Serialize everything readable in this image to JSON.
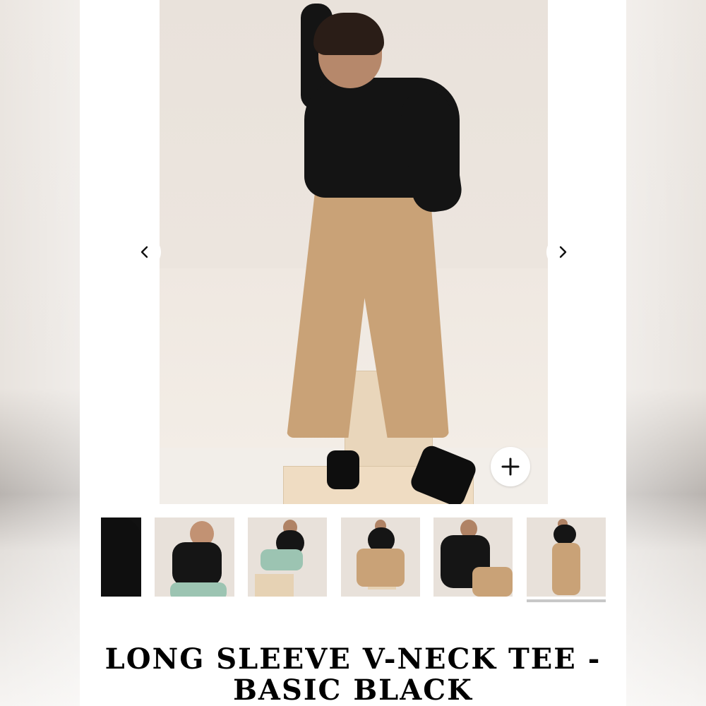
{
  "product": {
    "title": "LONG SLEEVE V-NECK TEE - BASIC BLACK"
  },
  "gallery": {
    "prev_icon": "chevron-left-icon",
    "next_icon": "chevron-right-icon",
    "zoom_icon": "plus-icon",
    "thumbnail_count": 6,
    "active_thumbnail": 6
  },
  "colors": {
    "background": "#ffffff",
    "title": "#000000",
    "tee": "#141414",
    "pants_tan": "#c9a277",
    "pants_mint": "#9cc4b2"
  }
}
